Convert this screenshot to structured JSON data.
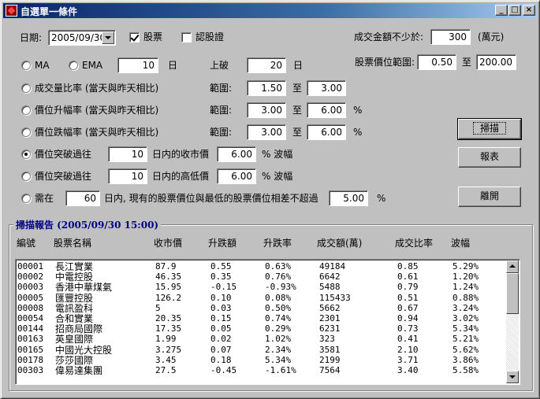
{
  "window": {
    "title": "自選單一條件"
  },
  "top": {
    "date_label": "日期:",
    "date_value": "2005/09/30",
    "stock_label": "股票",
    "stock_checked": true,
    "warrant_label": "認股證",
    "warrant_checked": false,
    "min_amount_label": "成交金額不少於:",
    "min_amount_value": "300",
    "min_amount_unit": "(萬元)",
    "price_range_label": "股票價位範圍:",
    "price_min": "0.50",
    "price_to": "至",
    "price_max": "200.00"
  },
  "conditions": {
    "ma_label": "MA",
    "ema_label": "EMA",
    "ma_days": "10",
    "days_unit": "日",
    "break_label": "上破",
    "break_days": "20",
    "vol_ratio_label": "成交量比率 (當天與昨天相比)",
    "range_label": "範圍:",
    "to_label": "至",
    "pct": "%",
    "vol_min": "1.50",
    "vol_max": "3.00",
    "rise_label": "價位升幅率 (當天與昨天相比)",
    "rise_min": "3.00",
    "rise_max": "6.00",
    "fall_label": "價位跌幅率 (當天與昨天相比)",
    "fall_min": "3.00",
    "fall_max": "6.00",
    "breakout_close_label": "價位突破過往",
    "breakout_close_days": "10",
    "close_price_label": "日内的收市價",
    "breakout_close_amp": "6.00",
    "amp_label": "% 波幅",
    "breakout_hl_label": "價位突破過往",
    "breakout_hl_days": "10",
    "hl_price_label": "日内的高低價",
    "breakout_hl_amp": "6.00",
    "within_label": "需在",
    "within_days": "60",
    "within_text": "日内, 現有的股票價位與最低的股票價位相差不超過",
    "within_pct": "5.00"
  },
  "buttons": {
    "scan": "掃描",
    "report": "報表",
    "leave": "離開"
  },
  "report": {
    "title": "掃描報告 (2005/09/30 15:00)",
    "columns": [
      "編號",
      "股票名稱",
      "收市價",
      "升跌額",
      "升跌率",
      "成交額(萬)",
      "成交比率",
      "波幅"
    ],
    "rows": [
      [
        "00001",
        "長江實業",
        "87.9",
        "0.55",
        "0.63%",
        "49184",
        "0.85",
        "5.29%"
      ],
      [
        "00002",
        "中電控股",
        "46.35",
        "0.35",
        "0.76%",
        "6642",
        "0.61",
        "1.20%"
      ],
      [
        "00003",
        "香港中華煤氣",
        "15.95",
        "-0.15",
        "-0.93%",
        "5488",
        "0.79",
        "1.24%"
      ],
      [
        "00005",
        "匯豐控股",
        "126.2",
        "0.10",
        "0.08%",
        "115433",
        "0.51",
        "0.88%"
      ],
      [
        "00008",
        "電訊盈科",
        "5",
        "0.03",
        "0.50%",
        "5662",
        "0.67",
        "3.24%"
      ],
      [
        "00054",
        "合和實業",
        "20.35",
        "0.15",
        "0.74%",
        "2301",
        "0.94",
        "3.02%"
      ],
      [
        "00144",
        "招商局國際",
        "17.35",
        "0.05",
        "0.29%",
        "6231",
        "0.73",
        "5.34%"
      ],
      [
        "00163",
        "英皇國際",
        "1.99",
        "0.02",
        "1.02%",
        "323",
        "0.41",
        "5.21%"
      ],
      [
        "00165",
        "中國光大控股",
        "3.275",
        "0.07",
        "2.34%",
        "3581",
        "2.10",
        "5.62%"
      ],
      [
        "00178",
        "莎莎國際",
        "3.45",
        "0.18",
        "5.34%",
        "2199",
        "3.71",
        "3.86%"
      ],
      [
        "00303",
        "偉易達集團",
        "27.5",
        "-0.45",
        "-1.61%",
        "7564",
        "3.40",
        "5.58%"
      ]
    ]
  }
}
